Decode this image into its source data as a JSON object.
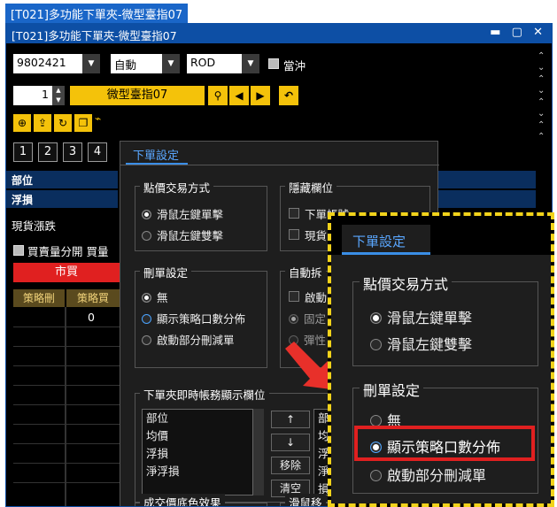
{
  "outer_tab": {
    "title": "[T021]多功能下單夾-微型臺指07"
  },
  "window": {
    "title": "[T021]多功能下單夾-微型臺指07",
    "controls": "▬ ▢ ✕"
  },
  "toolbar": {
    "account": "9802421",
    "mode": "自動",
    "order_type": "ROD",
    "day_trade_label": "當沖",
    "quantity": "1",
    "product": "微型臺指07"
  },
  "tabs_numbers": [
    "1",
    "2",
    "3",
    "4"
  ],
  "left_rows": {
    "position": "部位",
    "floating": "浮損",
    "spot": "現貨漲跌",
    "split_label": "買賣量分開 買量",
    "market_buy": "市買",
    "col1": "策略刪",
    "col2": "策略買",
    "val": "0"
  },
  "dialog": {
    "tab": "下單設定",
    "point_trade": {
      "title": "點價交易方式",
      "options": [
        "滑鼠左鍵單擊",
        "滑鼠左鍵雙擊"
      ]
    },
    "hidden_cols": {
      "title": "隱藏欄位",
      "items": [
        "下單帳號",
        "現貨"
      ]
    },
    "delete_settings": {
      "title": "刪單設定",
      "options": [
        "無",
        "顯示策略口數分佈",
        "啟動部分刪減單"
      ]
    },
    "auto": {
      "title": "自動拆",
      "items": [
        "啟動",
        "固定",
        "彈性"
      ]
    },
    "account_display": {
      "title": "下單夾即時帳務顯示欄位",
      "items": [
        "部位",
        "均價",
        "浮損",
        "淨浮損"
      ],
      "buttons": [
        "↑",
        "↓",
        "移除",
        "清空"
      ],
      "right_items": [
        "部位",
        "均價",
        "浮損",
        "淨浮損"
      ]
    },
    "deal_color": {
      "title": "成交價底色效果"
    },
    "mouse_move": {
      "title": "滑鼠移"
    }
  },
  "callout": {
    "tab": "下單設定",
    "point_trade_title": "點價交易方式",
    "point_options": [
      "滑鼠左鍵單擊",
      "滑鼠左鍵雙擊"
    ],
    "delete_title": "刪單設定",
    "delete_options": [
      "無",
      "顯示策略口數分佈",
      "啟動部分刪減單"
    ]
  },
  "colors": {
    "accent_blue": "#0d4fa5",
    "yellow": "#f4c20a",
    "red": "#e02020",
    "callout": "#f2d31b"
  }
}
